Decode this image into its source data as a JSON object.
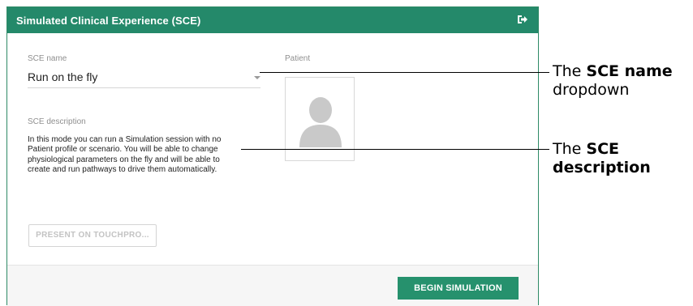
{
  "window": {
    "title": "Simulated Clinical Experience (SCE)",
    "exit_icon": "sign-out-icon"
  },
  "form": {
    "sce_name_label": "SCE name",
    "sce_name_value": "Run on the fly",
    "sce_description_label": "SCE description",
    "sce_description_lines": [
      "In this mode you can run a Simulation session with no",
      "Patient profile or scenario. You will be able to change",
      "physiological parameters on the fly and will be able to",
      "create and run pathways to drive them automatically."
    ],
    "patient_label": "Patient",
    "patient_icon": "user-placeholder-icon"
  },
  "buttons": {
    "present_label": "PRESENT ON TOUCHPRO...",
    "begin_label": "BEGIN SIMULATION"
  },
  "colors": {
    "header": "#24896a",
    "primary_button": "#26916d"
  },
  "annotations": {
    "name_callout": {
      "prefix": "The ",
      "bold": "SCE name",
      "suffix": "dropdown"
    },
    "description_callout": {
      "prefix": "The ",
      "bold1": "SCE",
      "bold2": "description"
    }
  }
}
